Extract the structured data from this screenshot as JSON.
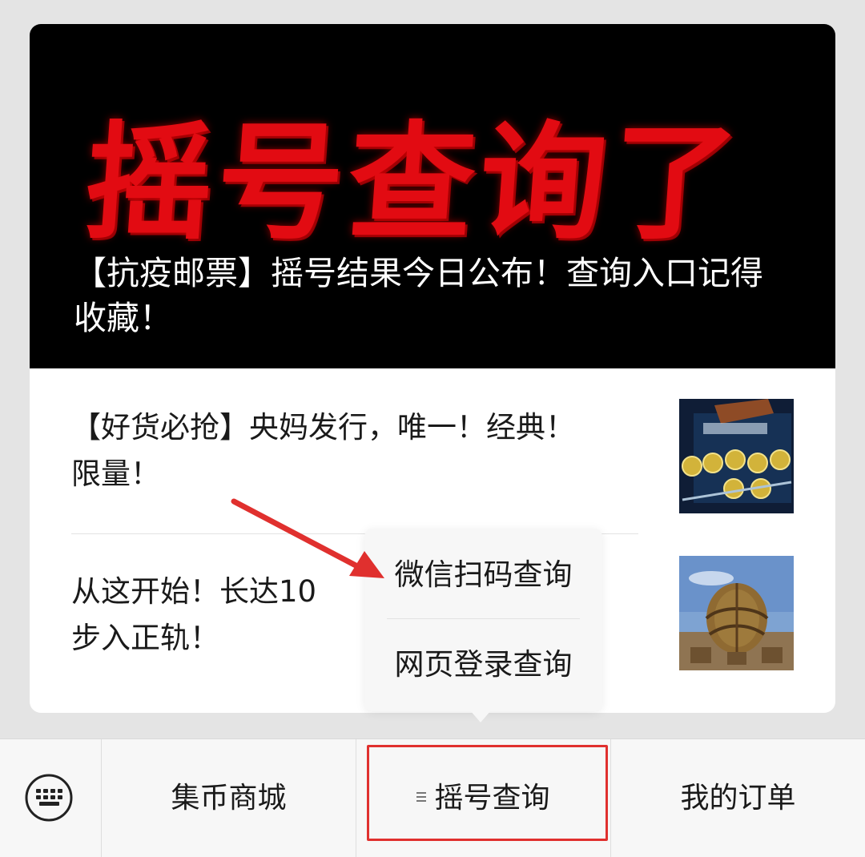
{
  "hero": {
    "big_text": "摇号查询了",
    "title": "【抗疫邮票】摇号结果今日公布！查询入口记得收藏！"
  },
  "articles": [
    {
      "title": "【好货必抢】央妈发行，唯一！经典！限量！"
    },
    {
      "title": "从这开始！长达10年步入正轨！",
      "visible_title_line1": "从这开始！长达10",
      "visible_title_line2": "步入正轨！"
    }
  ],
  "popup_menu": {
    "items": [
      "微信扫码查询",
      "网页登录查询"
    ]
  },
  "bottom_menu": {
    "keyboard_icon": "keyboard-icon",
    "items": [
      "集币商城",
      "摇号查询",
      "我的订单"
    ]
  },
  "colors": {
    "accent_red": "#e0302e",
    "hero_red": "#e20b12",
    "background": "#e4e4e4"
  }
}
